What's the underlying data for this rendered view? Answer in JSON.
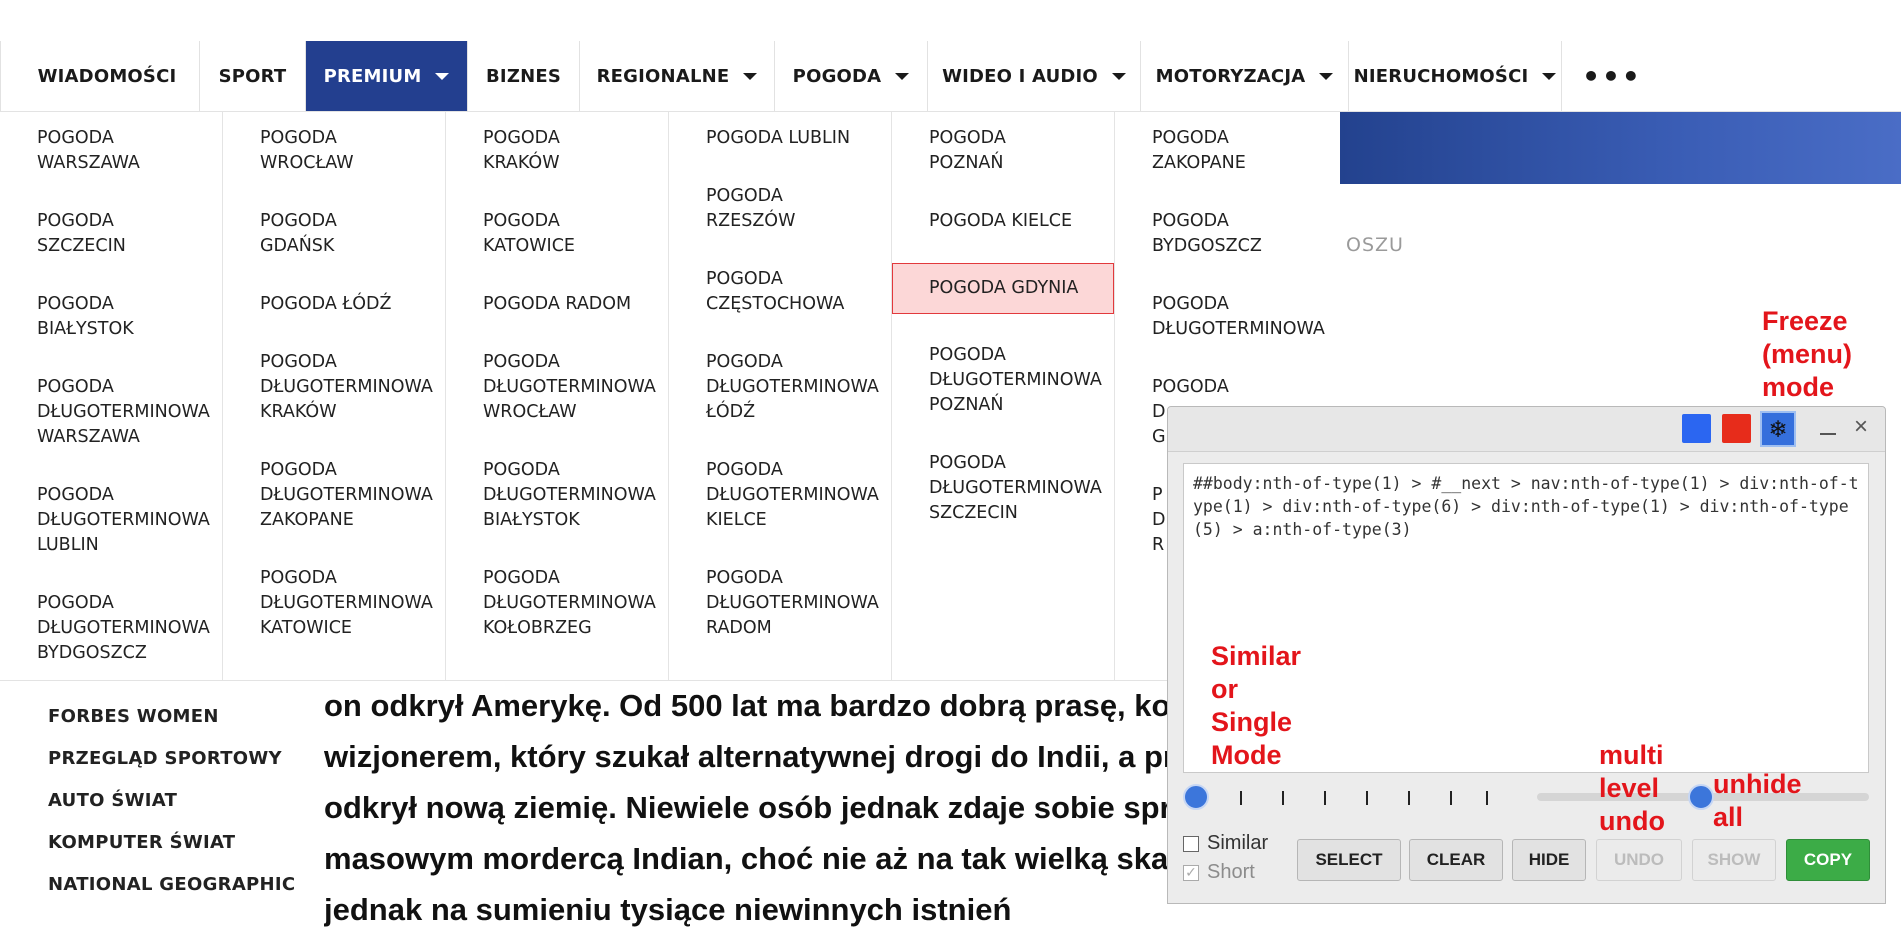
{
  "nav": {
    "items": [
      {
        "label": "WIADOMOŚCI",
        "caret": false,
        "active": false
      },
      {
        "label": "SPORT",
        "caret": false,
        "active": false
      },
      {
        "label": "PREMIUM",
        "caret": true,
        "active": true
      },
      {
        "label": "BIZNES",
        "caret": false,
        "active": false
      },
      {
        "label": "REGIONALNE",
        "caret": true,
        "active": false
      },
      {
        "label": "POGODA",
        "caret": true,
        "active": false
      },
      {
        "label": "WIDEO I AUDIO",
        "caret": true,
        "active": false
      },
      {
        "label": "MOTORYZACJA",
        "caret": true,
        "active": false
      },
      {
        "label": "NIERUCHOMOŚCI",
        "caret": true,
        "active": false
      }
    ],
    "more": "•••",
    "active_color": "#233f8f"
  },
  "weather_menu": {
    "columns": [
      [
        "POGODA\nWARSZAWA",
        "POGODA\nSZCZECIN",
        "POGODA\nBIAŁYSTOK",
        "POGODA\nDŁUGOTERMINOWA\nWARSZAWA",
        "POGODA\nDŁUGOTERMINOWA\nLUBLIN",
        "POGODA\nDŁUGOTERMINOWA\nBYDGOSZCZ"
      ],
      [
        "POGODA\nWROCŁAW",
        "POGODA\nGDAŃSK",
        "POGODA ŁÓDŹ",
        "POGODA\nDŁUGOTERMINOWA\nKRAKÓW",
        "POGODA\nDŁUGOTERMINOWA\nZAKOPANE",
        "POGODA\nDŁUGOTERMINOWA\nKATOWICE"
      ],
      [
        "POGODA\nKRAKÓW",
        "POGODA\nKATOWICE",
        "POGODA RADOM",
        "POGODA\nDŁUGOTERMINOWA\nWROCŁAW",
        "POGODA\nDŁUGOTERMINOWA\nBIAŁYSTOK",
        "POGODA\nDŁUGOTERMINOWA\nKOŁOBRZEG"
      ],
      [
        "POGODA LUBLIN",
        "POGODA\nRZESZÓW",
        "POGODA\nCZĘSTOCHOWA",
        "POGODA\nDŁUGOTERMINOWA\nŁÓDŹ",
        "POGODA\nDŁUGOTERMINOWA\nKIELCE",
        "POGODA\nDŁUGOTERMINOWA\nRADOM"
      ],
      [
        "POGODA\nPOZNAŃ",
        "POGODA KIELCE",
        "POGODA GDYNIA",
        "POGODA\nDŁUGOTERMINOWA\nPOZNAŃ",
        "POGODA\nDŁUGOTERMINOWA\nSZCZECIN"
      ],
      [
        "POGODA\nZAKOPANE",
        "POGODA\nBYDGOSZCZ",
        "POGODA\nDŁUGOTERMINOWA",
        "POGODA\nD\nG",
        "P\nD\nR"
      ]
    ],
    "highlighted": "POGODA GDYNIA"
  },
  "page": {
    "side_text": "OSZU",
    "footer_links": [
      "FORBES WOMEN",
      "PRZEGLĄD SPORTOWY",
      "AUTO ŚWIAT",
      "KOMPUTER ŚWIAT",
      "NATIONAL GEOGRAPHIC"
    ],
    "article_lines": [
      "on odkrył Amerykę. Od 500 lat ma bardzo dobrą prasę, koja",
      "wizjonerem, który szukał alternatywnej drogi do Indii, a prz",
      "odkrył nową ziemię. Niewiele osób jednak zdaje sobie spra",
      "masowym mordercą Indian, choć nie aż na tak wielką skalę,",
      "jednak na sumieniu tysiące niewinnych istnień"
    ]
  },
  "annotations": {
    "freeze": "Freeze\n(menu)\nmode",
    "similar": "Similar\nor\nSingle\nMode",
    "undo": "multi\nlevel\nundo",
    "unhide": "unhide\nall",
    "color": "#e3151b"
  },
  "panel": {
    "freeze_icon": "❄",
    "minimize_icon": "_",
    "close_icon": "×",
    "selector": "##body:nth-of-type(1) > #__next > nav:nth-of-type(1) > div:nth-of-type(1) > div:nth-of-type(6) > div:nth-of-type(1) > div:nth-of-type(5) > a:nth-of-type(3)",
    "similar_label": "Similar",
    "short_label": "Short",
    "similar_checked": false,
    "short_checked": true,
    "buttons": {
      "select": "SELECT",
      "clear": "CLEAR",
      "hide": "HIDE",
      "undo": "UNDO",
      "show": "SHOW",
      "copy": "COPY"
    },
    "colors": {
      "blue": "#2b66f1",
      "red": "#e72c1b",
      "copy": "#3cac47"
    }
  }
}
